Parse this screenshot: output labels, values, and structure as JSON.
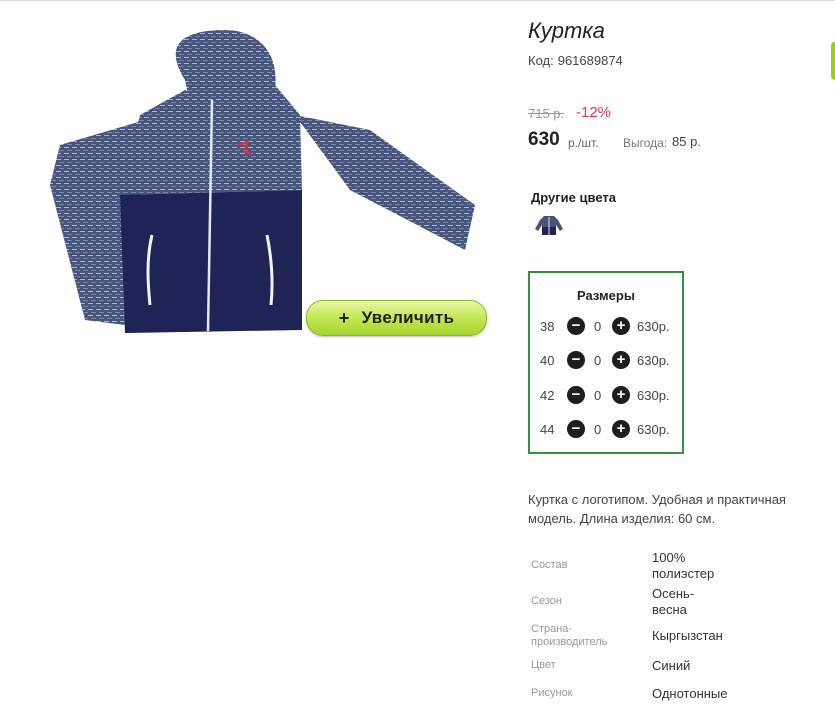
{
  "product": {
    "title": "Куртка",
    "code_label": "Код:",
    "code_value": "961689874",
    "old_price": "715 р.",
    "discount": "-12%",
    "price": "630",
    "price_unit": "р./шт.",
    "benefit_label": "Выгода:",
    "benefit_value": "85 р."
  },
  "image": {
    "zoom_label": "Увеличить",
    "zoom_plus": "+"
  },
  "colors": {
    "heading": "Другие цвета"
  },
  "sizes": {
    "title": "Размеры",
    "rows": [
      {
        "size": "38",
        "qty": "0",
        "price": "630р."
      },
      {
        "size": "40",
        "qty": "0",
        "price": "630р."
      },
      {
        "size": "42",
        "qty": "0",
        "price": "630р."
      },
      {
        "size": "44",
        "qty": "0",
        "price": "630р."
      }
    ]
  },
  "description": "Куртка с логотипом. Удобная и практичная модель. Длина изделия: 60 см.",
  "specs": [
    {
      "label": "Состав",
      "value": "100% полиэстер"
    },
    {
      "label": "Сезон",
      "value": "Осень-весна"
    },
    {
      "label": "Страна-производитель",
      "value": "Кыргызстан"
    },
    {
      "label": "Цвет",
      "value": "Синий"
    },
    {
      "label": "Рисунок",
      "value": "Однотонные"
    }
  ],
  "colors_palette": {
    "accent_green": "#9ccc20",
    "border_green": "#3a8f3a",
    "discount_red": "#e0325e"
  }
}
